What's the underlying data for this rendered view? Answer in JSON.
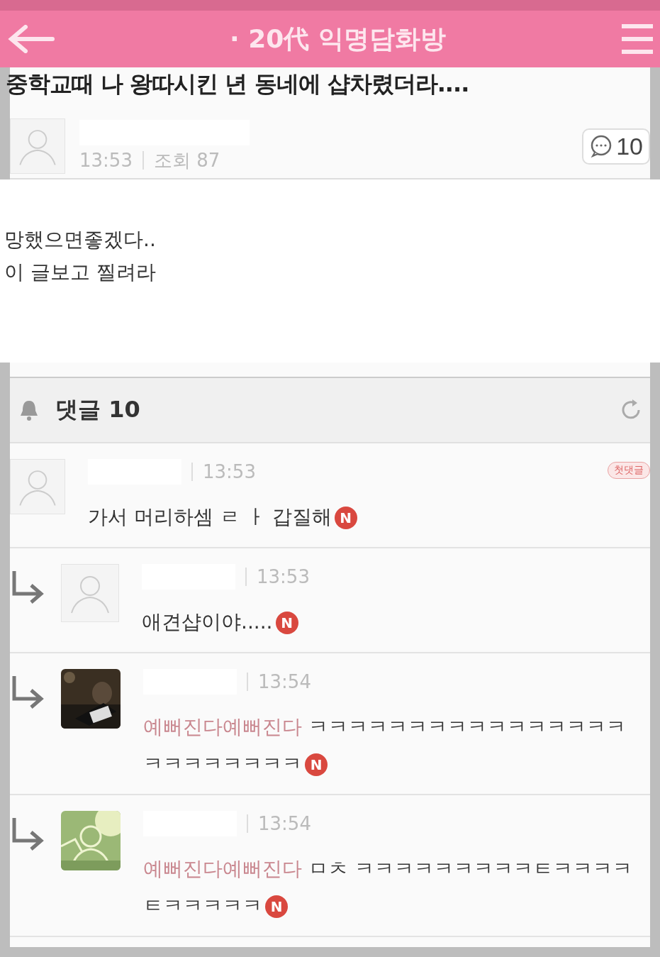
{
  "header": {
    "title": "· 20代 익명담화방"
  },
  "post": {
    "title": "중학교때 나 왕따시킨 년 동네에 샵차렸더라....",
    "time": "13:53",
    "views": "조회 87",
    "comment_count": "10",
    "body": [
      "망했으면좋겠다..",
      "이 글보고 찔려라"
    ]
  },
  "comments_header": {
    "label": "댓글 10"
  },
  "comments": [
    {
      "kind": "comment",
      "avatar": {
        "kind": "default"
      },
      "time": "13:53",
      "tag": "첫댓글",
      "text": "가서 머리하셈 ㄹ ㅏ 갑질해",
      "badge": "N"
    },
    {
      "kind": "reply",
      "avatar": {
        "kind": "default"
      },
      "time": "13:53",
      "text": "애견샵이야.....",
      "badge": "N"
    },
    {
      "kind": "reply",
      "time": "13:54",
      "mention": "예뻐진다예뻐진다",
      "text": "ㅋㅋㅋㅋㅋㅋㅋㅋㅋㅋㅋㅋㅋㅋㅋㅋㅋㅋㅋㅋㅋㅋㅋㅋ",
      "badge": "N"
    },
    {
      "kind": "reply",
      "time": "13:54",
      "mention": "예뻐진다예뻐진다",
      "text": "ㅁㅊ ㅋㅋㅋㅋㅋㅋㅋㅋㅋㅌㅋㅋㅋㅋㅌㅋㅋㅋㅋㅋ",
      "badge": "N"
    }
  ]
}
